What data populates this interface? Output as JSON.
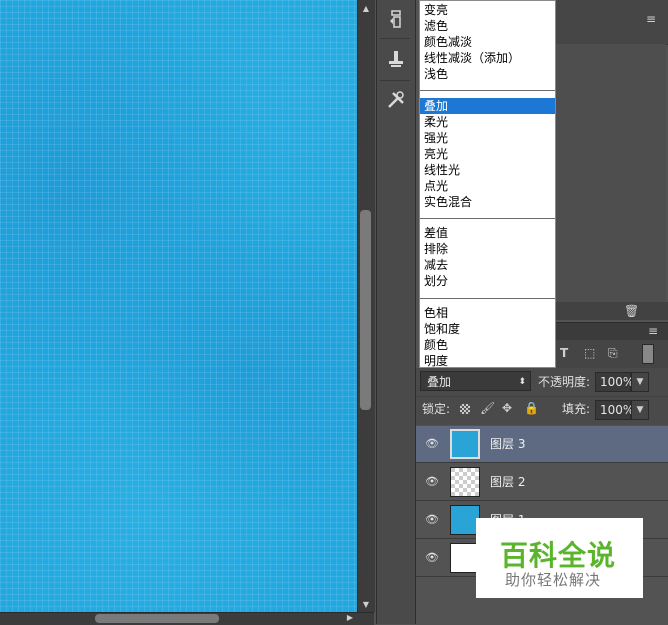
{
  "blend_menu": {
    "group1": [
      "变亮",
      "滤色",
      "颜色减淡",
      "线性减淡（添加）",
      "浅色"
    ],
    "group2": [
      "叠加",
      "柔光",
      "强光",
      "亮光",
      "线性光",
      "点光",
      "实色混合"
    ],
    "group3": [
      "差值",
      "排除",
      "减去",
      "划分"
    ],
    "group4": [
      "色相",
      "饱和度",
      "颜色",
      "明度"
    ],
    "selected": "叠加"
  },
  "layers_panel": {
    "blend_mode": "叠加",
    "opacity_label": "不透明度:",
    "opacity_value": "100%",
    "lock_label": "锁定:",
    "fill_label": "填充:",
    "fill_value": "100%"
  },
  "layers": [
    {
      "name": "图层 3",
      "selected": true,
      "thumb": "blue"
    },
    {
      "name": "图层 2",
      "selected": false,
      "thumb": "transparent"
    },
    {
      "name": "图层 1",
      "selected": false,
      "thumb": "blue"
    },
    {
      "name": "",
      "selected": false,
      "thumb": "white"
    }
  ],
  "watermark": {
    "title": "百科全说",
    "subtitle": "助你轻松解决"
  },
  "colors": {
    "accent": "#1c78d4",
    "selected_layer": "#5d6a81",
    "canvas": "#22a7e0",
    "watermark_green": "#5bb52c"
  }
}
